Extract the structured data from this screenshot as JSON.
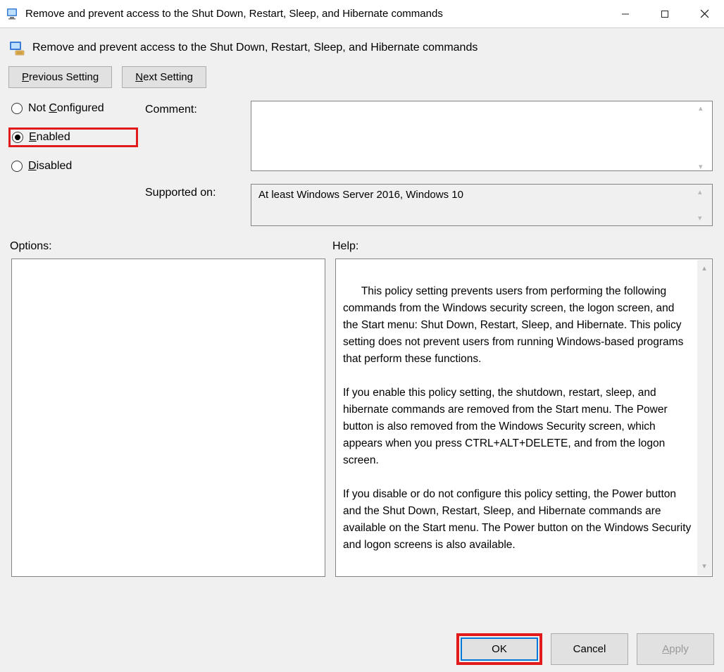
{
  "window": {
    "title": "Remove and prevent access to the Shut Down, Restart, Sleep, and Hibernate commands"
  },
  "header": {
    "title": "Remove and prevent access to the Shut Down, Restart, Sleep, and Hibernate commands"
  },
  "nav": {
    "previous_prefix": "P",
    "previous_rest": "revious Setting",
    "next_prefix": "N",
    "next_rest": "ext Setting"
  },
  "radio": {
    "not_configured_prefix": "Not ",
    "not_configured_u": "C",
    "not_configured_rest": "onfigured",
    "enabled_u": "E",
    "enabled_rest": "nabled",
    "disabled_u": "D",
    "disabled_rest": "isabled",
    "selected": "enabled"
  },
  "fields": {
    "comment_label": "Comment:",
    "comment_value": "",
    "supported_label": "Supported on:",
    "supported_value": "At least Windows Server 2016, Windows 10"
  },
  "sections": {
    "options_label": "Options:",
    "help_label": "Help:"
  },
  "help_text": "This policy setting prevents users from performing the following commands from the Windows security screen, the logon screen, and the Start menu: Shut Down, Restart, Sleep, and Hibernate. This policy setting does not prevent users from running Windows-based programs that perform these functions.\n\nIf you enable this policy setting, the shutdown, restart, sleep, and hibernate commands are removed from the Start menu. The Power button is also removed from the Windows Security screen, which appears when you press CTRL+ALT+DELETE, and from the logon screen.\n\nIf you disable or do not configure this policy setting, the Power button and the Shut Down, Restart, Sleep, and Hibernate commands are available on the Start menu. The Power button on the Windows Security and logon screens is also available.",
  "footer": {
    "ok": "OK",
    "cancel": "Cancel",
    "apply_u": "A",
    "apply_rest": "pply"
  }
}
